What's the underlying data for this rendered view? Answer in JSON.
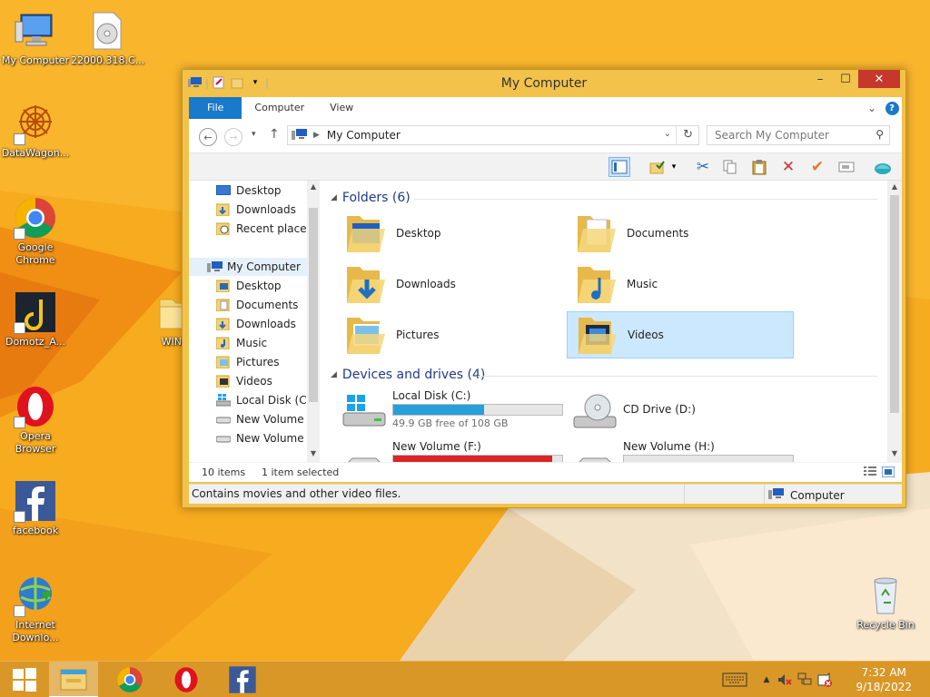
{
  "desktop": {
    "icons": [
      {
        "label": "My Computer"
      },
      {
        "label": "22000.318.C..."
      },
      {
        "label": "DataWagon..."
      },
      {
        "label": "Google Chrome"
      },
      {
        "label": "Domotz_A..."
      },
      {
        "label": "WIN"
      },
      {
        "label": "Opera Browser"
      },
      {
        "label": "facebook"
      },
      {
        "label": "Internet Downlo..."
      },
      {
        "label": "Recycle Bin"
      }
    ]
  },
  "window": {
    "title": "My Computer",
    "ribbon_tabs": [
      "File",
      "Computer",
      "View"
    ],
    "address_path": "My Computer",
    "search_placeholder": "Search My Computer",
    "nav_pane": [
      {
        "label": "Desktop",
        "level": "fav"
      },
      {
        "label": "Downloads",
        "level": "fav"
      },
      {
        "label": "Recent places",
        "level": "fav"
      },
      {
        "label": "My Computer",
        "level": "root"
      },
      {
        "label": "Desktop",
        "level": "child"
      },
      {
        "label": "Documents",
        "level": "child"
      },
      {
        "label": "Downloads",
        "level": "child"
      },
      {
        "label": "Music",
        "level": "child"
      },
      {
        "label": "Pictures",
        "level": "child"
      },
      {
        "label": "Videos",
        "level": "child"
      },
      {
        "label": "Local Disk (C:)",
        "level": "child"
      },
      {
        "label": "New Volume (E:)",
        "level": "child"
      },
      {
        "label": "New Volume (F:)",
        "level": "child"
      }
    ],
    "folders_header": "Folders (6)",
    "folders": [
      {
        "name": "Desktop",
        "icon": "desktop-folder-icon"
      },
      {
        "name": "Documents",
        "icon": "documents-folder-icon"
      },
      {
        "name": "Downloads",
        "icon": "downloads-folder-icon"
      },
      {
        "name": "Music",
        "icon": "music-folder-icon"
      },
      {
        "name": "Pictures",
        "icon": "pictures-folder-icon"
      },
      {
        "name": "Videos",
        "icon": "videos-folder-icon",
        "selected": true
      }
    ],
    "drives_header": "Devices and drives (4)",
    "drives": [
      {
        "name": "Local Disk (C:)",
        "free_text": "49.9 GB free of 108 GB",
        "used_fraction": 0.54,
        "bar_color": "#26a0da"
      },
      {
        "name": "CD Drive (D:)",
        "free_text": "",
        "used_fraction": null
      },
      {
        "name": "New Volume (F:)",
        "free_text": "",
        "used_fraction": 0.94,
        "bar_color": "#da2626"
      },
      {
        "name": "New Volume (H:)",
        "free_text": "",
        "used_fraction": 0.0
      }
    ],
    "item_count": "10 items",
    "selection_count": "1 item selected",
    "status_message": "Contains movies and other video files.",
    "status_location": "Computer"
  },
  "taskbar": {
    "apps": [
      "start-button",
      "file-explorer",
      "google-chrome",
      "opera",
      "facebook"
    ],
    "time": "7:32 AM",
    "date": "9/18/2022"
  },
  "colors": {
    "accent": "#1979ca",
    "selection": "#cce8ff",
    "drive_bar": "#26a0da",
    "drive_bar_full": "#da2626",
    "wallpaper": "#f5a623"
  }
}
